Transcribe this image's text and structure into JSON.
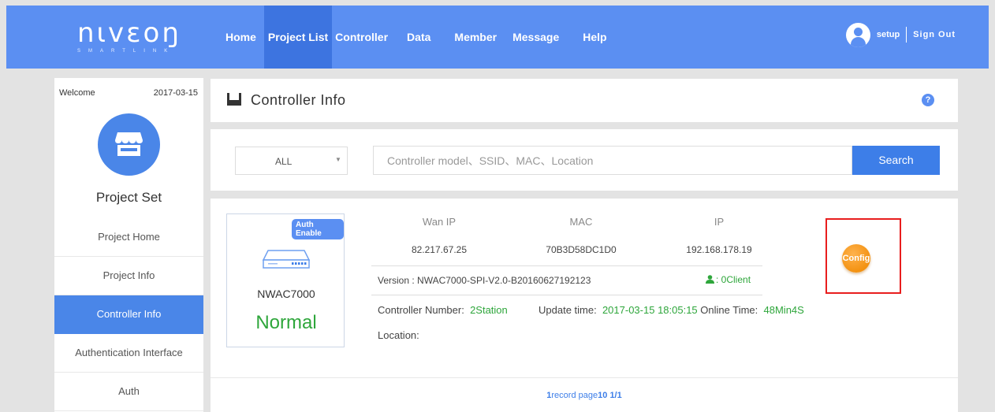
{
  "brand": {
    "logo": "nιvεoŋ",
    "tagline": "SMARTLINK"
  },
  "nav": {
    "items": [
      {
        "label": "Home",
        "active": false
      },
      {
        "label": "Project List",
        "active": true
      },
      {
        "label": "Controller",
        "active": false
      },
      {
        "label": "Data",
        "active": false
      },
      {
        "label": "Member",
        "active": false
      },
      {
        "label": "Message",
        "active": false
      },
      {
        "label": "Help",
        "active": false
      }
    ]
  },
  "user": {
    "name": "setup",
    "signout": "Sign Out"
  },
  "sidebar": {
    "welcome": "Welcome",
    "date": "2017-03-15",
    "title": "Project Set",
    "items": [
      {
        "label": "Project Home"
      },
      {
        "label": "Project Info"
      },
      {
        "label": "Controller Info",
        "active": true
      },
      {
        "label": "Authentication Interface"
      },
      {
        "label": "Auth"
      }
    ]
  },
  "header": {
    "title": "Controller Info",
    "help": "?"
  },
  "search": {
    "filter": "ALL",
    "placeholder": "Controller model、SSID、MAC、Location",
    "button": "Search"
  },
  "controller": {
    "badge": "Auth Enable",
    "model": "NWAC7000",
    "status": "Normal",
    "columns": {
      "wan_ip_label": "Wan IP",
      "wan_ip": "82.217.67.25",
      "mac_label": "MAC",
      "mac": "70B3D58DC1D0",
      "ip_label": "IP",
      "ip": "192.168.178.19"
    },
    "version": "Version : NWAC7000-SPI-V2.0-B20160627192123",
    "clients": ": 0Client",
    "number_label": "Controller Number:",
    "number": "2Station",
    "update_label": "Update time:",
    "update": "2017-03-15 18:05:15",
    "online_label": "Online Time:",
    "online": "48Min4S",
    "location_label": "Location:",
    "config": "Config"
  },
  "pager": {
    "count": "1",
    "record": "record",
    "page_label": "page",
    "page_size": "10",
    "pages": "1/1"
  },
  "colors": {
    "nav": "#5b8ff2",
    "active": "#4a86e8",
    "green": "#2ea63b",
    "config": "#f39211",
    "highlight": "#e81e1e"
  }
}
